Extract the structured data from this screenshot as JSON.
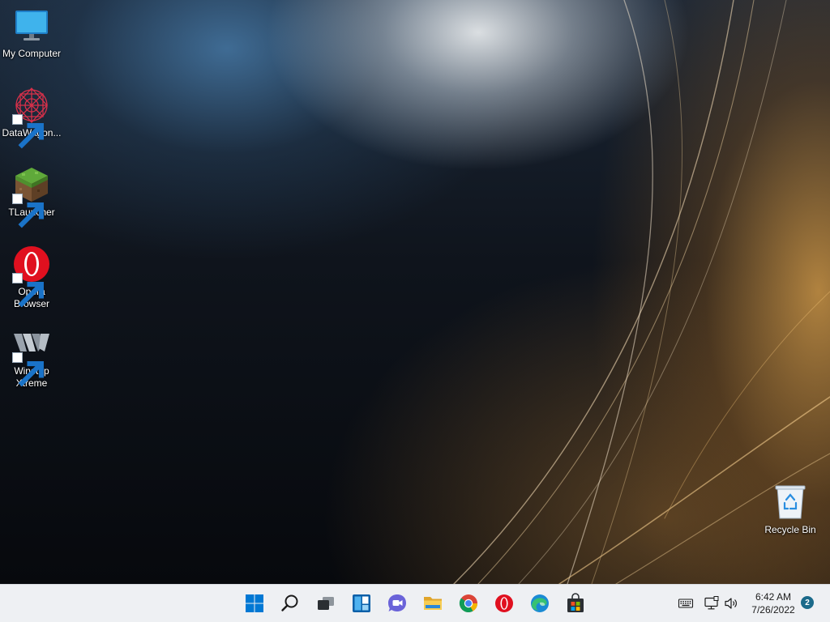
{
  "desktop": {
    "icons": [
      {
        "label": "My Computer",
        "icon": "monitor-icon"
      },
      {
        "label": "DataWagon...",
        "icon": "datawagon-icon",
        "shortcut": true
      },
      {
        "label": "TLauncher",
        "icon": "grass-block-icon",
        "shortcut": true
      },
      {
        "label": "Opera Browser",
        "icon": "opera-icon",
        "shortcut": true
      },
      {
        "label": "Winstep Xtreme",
        "icon": "winstep-icon",
        "shortcut": true
      }
    ],
    "recycle_bin": {
      "label": "Recycle Bin",
      "icon": "recycle-bin-icon"
    }
  },
  "taskbar": {
    "apps": [
      {
        "name": "Start",
        "icon": "windows-start-icon"
      },
      {
        "name": "Search",
        "icon": "search-icon"
      },
      {
        "name": "Task View",
        "icon": "task-view-icon"
      },
      {
        "name": "Widgets",
        "icon": "widgets-icon"
      },
      {
        "name": "Chat",
        "icon": "chat-icon"
      },
      {
        "name": "File Explorer",
        "icon": "folder-icon"
      },
      {
        "name": "Google Chrome",
        "icon": "chrome-icon"
      },
      {
        "name": "Opera",
        "icon": "opera-icon"
      },
      {
        "name": "Microsoft Edge",
        "icon": "edge-icon"
      },
      {
        "name": "Microsoft Store",
        "icon": "store-icon"
      }
    ],
    "tray": {
      "icons": [
        "keyboard-icon",
        "network-icon",
        "volume-icon"
      ],
      "time": "6:42 AM",
      "date": "7/26/2022",
      "notification_count": "2"
    }
  },
  "colors": {
    "taskbar_bg": "#eef0f3",
    "accent": "#0078d4",
    "badge": "#1b6a8a"
  }
}
